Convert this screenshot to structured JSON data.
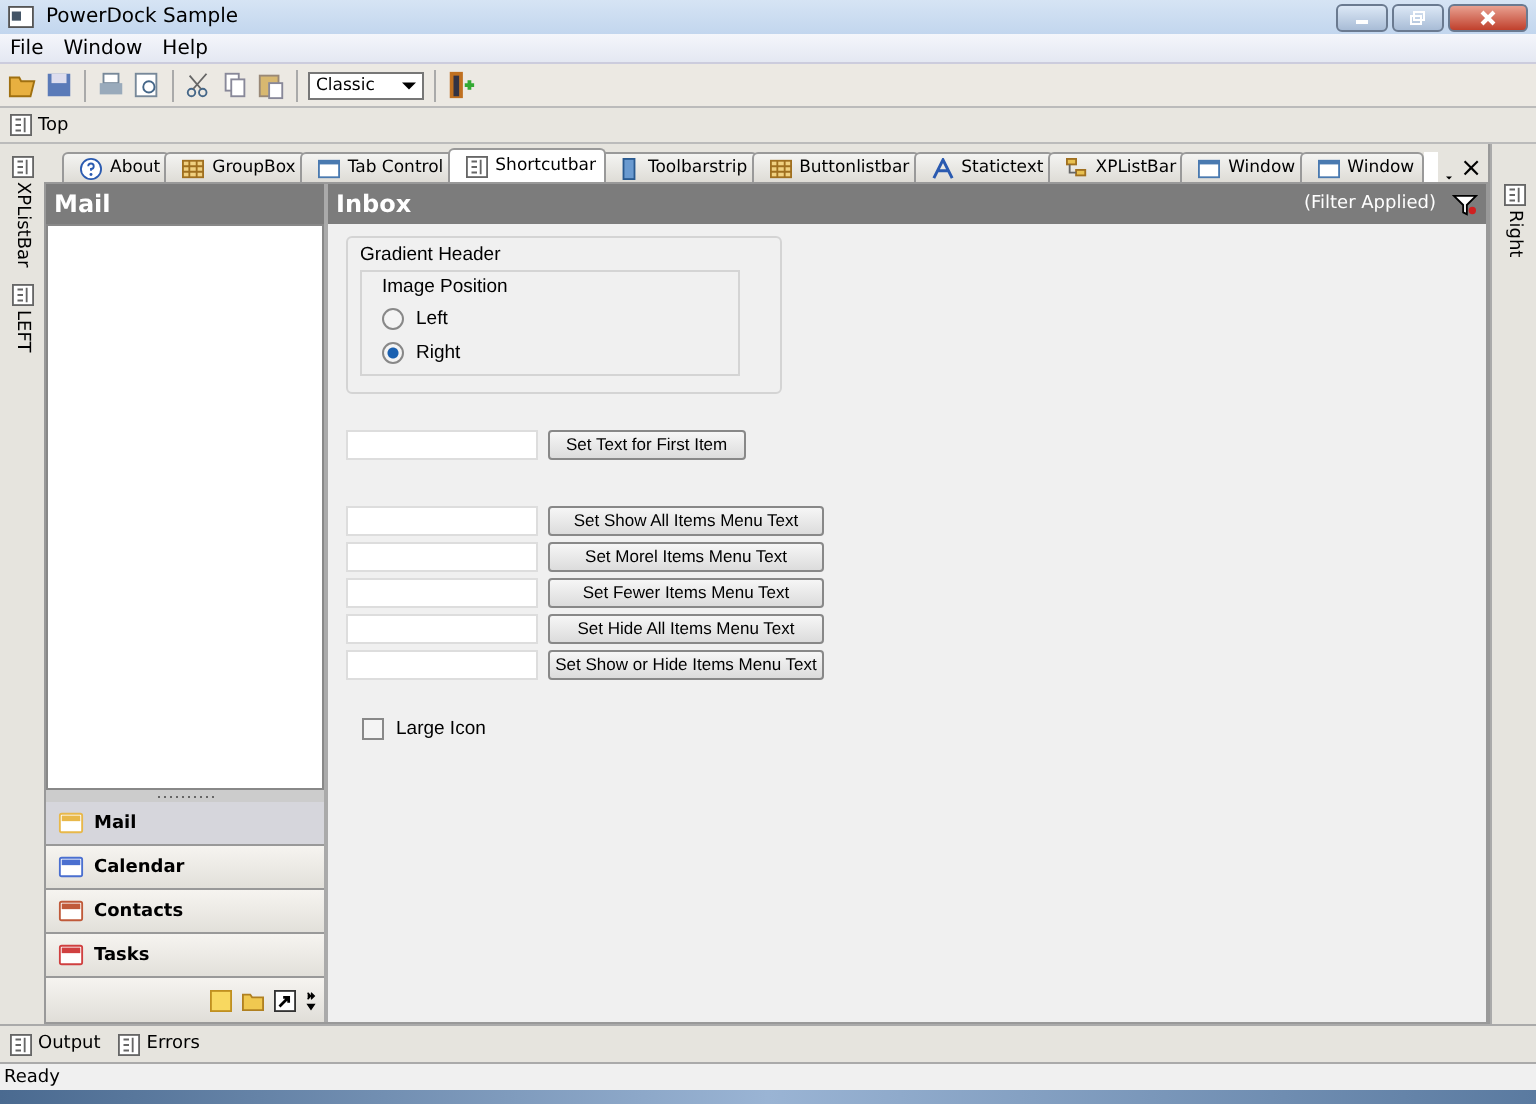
{
  "window": {
    "title": "PowerDock Sample"
  },
  "menu": [
    "File",
    "Window",
    "Help"
  ],
  "toolbar": {
    "combo": "Classic"
  },
  "top_dock": {
    "label": "Top"
  },
  "left_dock": [
    "XPListBar",
    "LEFT"
  ],
  "right_dock": [
    "Right"
  ],
  "tabs": [
    {
      "label": "About",
      "selected": false
    },
    {
      "label": "GroupBox",
      "selected": false
    },
    {
      "label": "Tab Control",
      "selected": false
    },
    {
      "label": "Shortcutbar",
      "selected": true
    },
    {
      "label": "Toolbarstrip",
      "selected": false
    },
    {
      "label": "Buttonlistbar",
      "selected": false
    },
    {
      "label": "Statictext",
      "selected": false
    },
    {
      "label": "XPListBar",
      "selected": false
    },
    {
      "label": "Window",
      "selected": false
    },
    {
      "label": "Window",
      "selected": false
    }
  ],
  "tab_close": "×",
  "mail_panel": {
    "title": "Mail",
    "items": [
      {
        "label": "Mail",
        "selected": true
      },
      {
        "label": "Calendar",
        "selected": false
      },
      {
        "label": "Contacts",
        "selected": false
      },
      {
        "label": "Tasks",
        "selected": false
      }
    ]
  },
  "inbox": {
    "title": "Inbox",
    "filter": "(Filter Applied)",
    "group": {
      "title": "Gradient Header",
      "inner_title": "Image Position",
      "options": [
        {
          "label": "Left",
          "selected": false
        },
        {
          "label": "Right",
          "selected": true
        }
      ]
    },
    "first_button": "Set Text for First Item",
    "menu_buttons": [
      "Set Show All Items Menu Text",
      "Set Morel Items Menu Text",
      "Set Fewer Items Menu Text",
      "Set Hide All Items Menu Text",
      "Set Show or Hide Items Menu Text"
    ],
    "large_icon": {
      "label": "Large Icon",
      "checked": false
    }
  },
  "bottom_dock": [
    "Output",
    "Errors"
  ],
  "status_bar": "Ready"
}
